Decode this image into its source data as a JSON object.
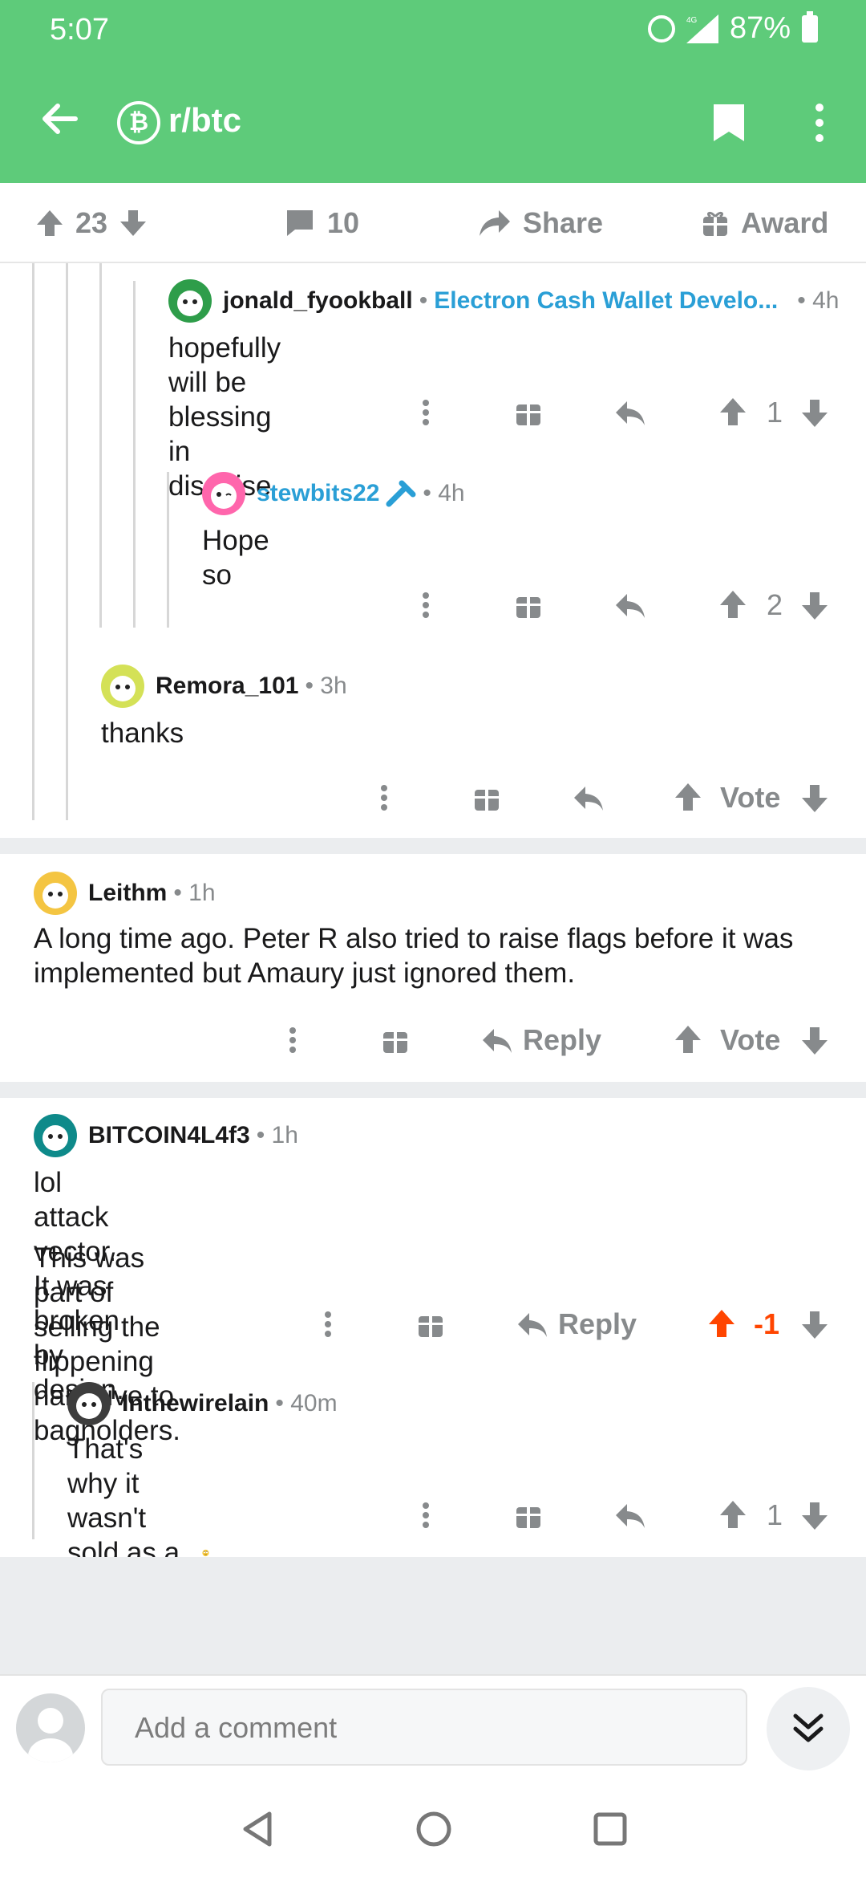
{
  "status_bar": {
    "time": "5:07",
    "network": "4G",
    "battery": "87%"
  },
  "header": {
    "subreddit": "r/btc",
    "sub_icon": "bitcoin-icon",
    "back": "back-arrow-icon",
    "bookmark": "bookmark-icon",
    "more": "more-vertical-icon"
  },
  "post_bar": {
    "upvotes": "23",
    "comments": "10",
    "share": "Share",
    "award": "Award"
  },
  "comments": [
    {
      "user": "jonald_fyookball",
      "flair": "Electron Cash Wallet Develo...",
      "age": "• 4h",
      "text": "hopefully will be blessing in disguise",
      "score": "1"
    },
    {
      "user": "stewbits22",
      "age": "• 4h",
      "text": "Hope so",
      "score": "2"
    },
    {
      "user": "Remora_101",
      "age": "• 3h",
      "text": "thanks",
      "score": "Vote"
    },
    {
      "user": "Leithm",
      "age": "• 1h",
      "text": "A long time ago.  Peter R also tried to raise flags before it was implemented but Amaury just ignored them.",
      "reply": "Reply",
      "score": "Vote"
    },
    {
      "user": "BITCOIN4L4f3",
      "age": "• 1h",
      "text_line1": "lol attack vector. It was broken by design.",
      "text_line2": "This was part of selling the flippening narrative to bagholders.",
      "reply": "Reply",
      "score": "-1"
    },
    {
      "user": "Inthewirelain",
      "age": "• 40m",
      "text": "That's why it wasn't sold as a feature. Makes sense.",
      "score": "1"
    }
  ],
  "composer": {
    "placeholder": "Add a comment"
  },
  "colors": {
    "brand_green": "#5ecb7a",
    "upvoted": "#ff4500",
    "flair_blue": "#2a9fd6",
    "meta_gray": "#878a8c"
  }
}
